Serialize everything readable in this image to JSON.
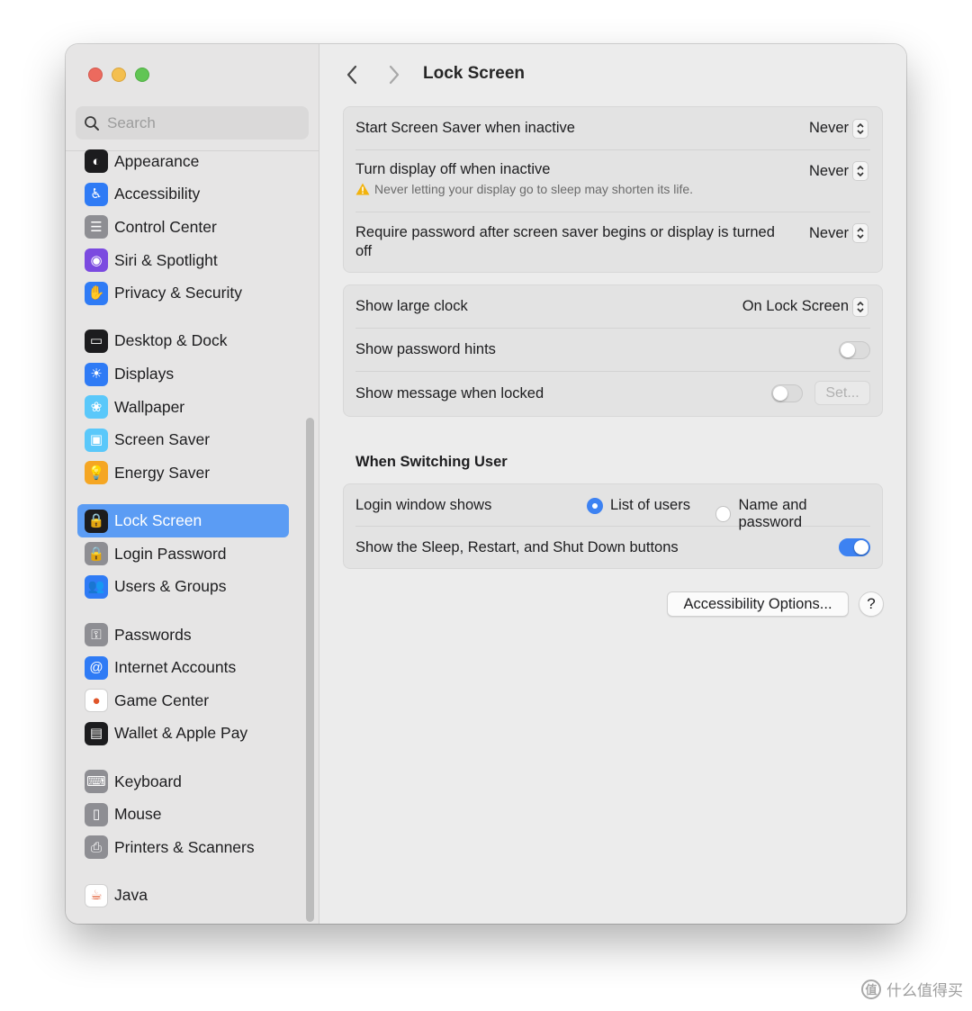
{
  "search": {
    "placeholder": "Search"
  },
  "sidebar": {
    "items": [
      {
        "label": "Appearance",
        "icon": "appearance-icon",
        "color": "#1c1c1e",
        "glyph": "◐"
      },
      {
        "label": "Accessibility",
        "icon": "accessibility-icon",
        "color": "#2f7bf5",
        "glyph": "♿"
      },
      {
        "label": "Control Center",
        "icon": "control-center-icon",
        "color": "#8e8e93",
        "glyph": "☰"
      },
      {
        "label": "Siri & Spotlight",
        "icon": "siri-icon",
        "color": "#7b4ae0",
        "glyph": "◉"
      },
      {
        "label": "Privacy & Security",
        "icon": "privacy-hand-icon",
        "color": "#2f7bf5",
        "glyph": "✋"
      },
      {
        "label": "Desktop & Dock",
        "icon": "desktop-dock-icon",
        "color": "#1c1c1e",
        "glyph": "▭"
      },
      {
        "label": "Displays",
        "icon": "displays-icon",
        "color": "#2f7bf5",
        "glyph": "☀"
      },
      {
        "label": "Wallpaper",
        "icon": "wallpaper-icon",
        "color": "#5ac8fa",
        "glyph": "❀"
      },
      {
        "label": "Screen Saver",
        "icon": "screen-saver-icon",
        "color": "#5ac8fa",
        "glyph": "▣"
      },
      {
        "label": "Energy Saver",
        "icon": "energy-saver-icon",
        "color": "#f5a623",
        "glyph": "💡"
      },
      {
        "label": "Lock Screen",
        "icon": "lock-screen-icon",
        "color": "#1c1c1e",
        "glyph": "🔒"
      },
      {
        "label": "Login Password",
        "icon": "login-password-icon",
        "color": "#8e8e93",
        "glyph": "🔒"
      },
      {
        "label": "Users & Groups",
        "icon": "users-groups-icon",
        "color": "#2f7bf5",
        "glyph": "👥"
      },
      {
        "label": "Passwords",
        "icon": "passwords-key-icon",
        "color": "#8e8e93",
        "glyph": "⚿"
      },
      {
        "label": "Internet Accounts",
        "icon": "internet-accounts-icon",
        "color": "#2f7bf5",
        "glyph": "@"
      },
      {
        "label": "Game Center",
        "icon": "game-center-icon",
        "color": "#ffffff",
        "glyph": "●"
      },
      {
        "label": "Wallet & Apple Pay",
        "icon": "wallet-icon",
        "color": "#1c1c1e",
        "glyph": "▤"
      },
      {
        "label": "Keyboard",
        "icon": "keyboard-icon",
        "color": "#8e8e93",
        "glyph": "⌨"
      },
      {
        "label": "Mouse",
        "icon": "mouse-icon",
        "color": "#8e8e93",
        "glyph": "▯"
      },
      {
        "label": "Printers & Scanners",
        "icon": "printer-icon",
        "color": "#8e8e93",
        "glyph": "⎙"
      },
      {
        "label": "Java",
        "icon": "java-icon",
        "color": "#ffffff",
        "glyph": "☕"
      }
    ],
    "selected_index": 10
  },
  "header": {
    "title": "Lock Screen"
  },
  "screen_group": {
    "rows": [
      {
        "label": "Start Screen Saver when inactive",
        "value": "Never"
      },
      {
        "label": "Turn display off when inactive",
        "value": "Never",
        "warning": "Never letting your display go to sleep may shorten its life."
      },
      {
        "label": "Require password after screen saver begins or display is turned off",
        "value": "Never"
      }
    ]
  },
  "clock_group": {
    "large_clock": {
      "label": "Show large clock",
      "value": "On Lock Screen"
    },
    "password_hints": {
      "label": "Show password hints",
      "on": false
    },
    "message": {
      "label": "Show message when locked",
      "on": false,
      "button": "Set..."
    }
  },
  "switching": {
    "heading": "When Switching User",
    "login_window": {
      "label": "Login window shows",
      "options": [
        "List of users",
        "Name and password"
      ],
      "selected": "List of users"
    },
    "power_buttons": {
      "label": "Show the Sleep, Restart, and Shut Down buttons",
      "on": true
    }
  },
  "footer": {
    "accessibility_button": "Accessibility Options...",
    "help_button": "?"
  },
  "colors": {
    "accent": "#3d82f2",
    "selection": "#5b9cf4"
  },
  "watermark": {
    "text": "什么值得买"
  }
}
